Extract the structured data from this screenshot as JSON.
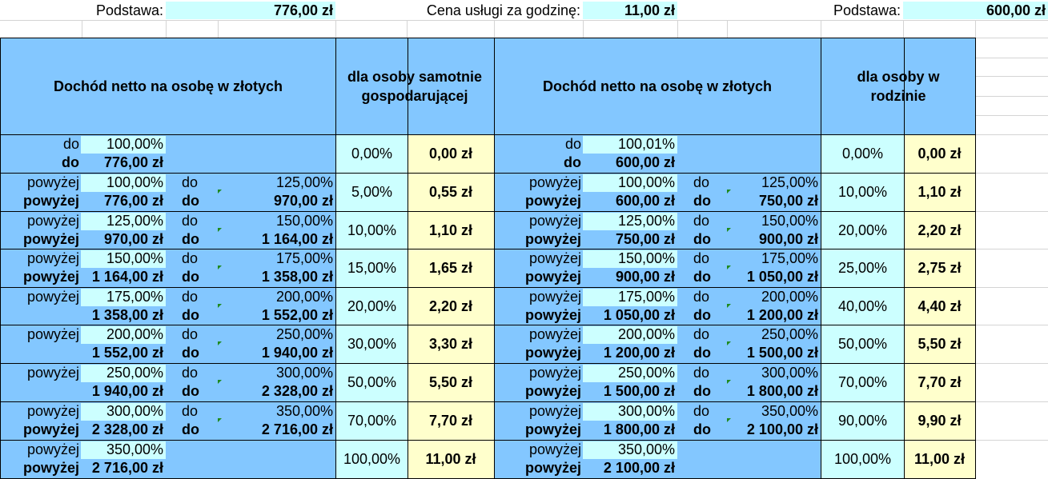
{
  "top": {
    "basis_label_1": "Podstawa:",
    "basis_value_1": "776,00 zł",
    "hourly_label": "Cena usługi za godzinę:",
    "hourly_value": "11,00 zł",
    "basis_label_2": "Podstawa:",
    "basis_value_2": "600,00 zł"
  },
  "headers": {
    "income_1": "Dochód netto na osobę w złotych",
    "single": "dla osoby samotnie gospodarującej",
    "income_2": "Dochód netto na osobę w złotych",
    "family": "dla osoby w rodzinie"
  },
  "left_rows": [
    {
      "l1": "do",
      "p1": "100,00%",
      "l2": "do",
      "a1": "776,00 zł",
      "l3": "",
      "p2": "",
      "l4": "",
      "a2": "",
      "pct": "0,00%",
      "fee": "0,00 zł"
    },
    {
      "l1": "powyżej",
      "p1": "100,00%",
      "l2": "powyżej",
      "a1": "776,00 zł",
      "l3": "do",
      "p2": "125,00%",
      "l4": "do",
      "a2": "970,00 zł",
      "pct": "5,00%",
      "fee": "0,55 zł"
    },
    {
      "l1": "powyżej",
      "p1": "125,00%",
      "l2": "powyżej",
      "a1": "970,00 zł",
      "l3": "do",
      "p2": "150,00%",
      "l4": "do",
      "a2": "1 164,00 zł",
      "pct": "10,00%",
      "fee": "1,10 zł"
    },
    {
      "l1": "powyżej",
      "p1": "150,00%",
      "l2": "powyżej",
      "a1": "1 164,00 zł",
      "l3": "do",
      "p2": "175,00%",
      "l4": "do",
      "a2": "1 358,00 zł",
      "pct": "15,00%",
      "fee": "1,65 zł"
    },
    {
      "l1": "powyżej",
      "p1": "175,00%",
      "l2": "",
      "a1": "1 358,00 zł",
      "l3": "do",
      "p2": "200,00%",
      "l4": "do",
      "a2": "1 552,00 zł",
      "pct": "20,00%",
      "fee": "2,20 zł"
    },
    {
      "l1": "powyżej",
      "p1": "200,00%",
      "l2": "",
      "a1": "1 552,00 zł",
      "l3": "do",
      "p2": "250,00%",
      "l4": "do",
      "a2": "1 940,00 zł",
      "pct": "30,00%",
      "fee": "3,30 zł"
    },
    {
      "l1": "powyżej",
      "p1": "250,00%",
      "l2": "",
      "a1": "1 940,00 zł",
      "l3": "do",
      "p2": "300,00%",
      "l4": "do",
      "a2": "2 328,00 zł",
      "pct": "50,00%",
      "fee": "5,50 zł"
    },
    {
      "l1": "powyżej",
      "p1": "300,00%",
      "l2": "powyżej",
      "a1": "2 328,00 zł",
      "l3": "do",
      "p2": "350,00%",
      "l4": "do",
      "a2": "2 716,00 zł",
      "pct": "70,00%",
      "fee": "7,70 zł"
    },
    {
      "l1": "powyżej",
      "p1": "350,00%",
      "l2": "powyżej",
      "a1": "2 716,00 zł",
      "l3": "",
      "p2": "",
      "l4": "",
      "a2": "",
      "pct": "100,00%",
      "fee": "11,00 zł"
    }
  ],
  "right_rows": [
    {
      "l1": "do",
      "p1": "100,01%",
      "l2": "do",
      "a1": "600,00 zł",
      "l3": "",
      "p2": "",
      "l4": "",
      "a2": "",
      "pct": "0,00%",
      "fee": "0,00 zł"
    },
    {
      "l1": "powyżej",
      "p1": "100,00%",
      "l2": "powyżej",
      "a1": "600,00 zł",
      "l3": "do",
      "p2": "125,00%",
      "l4": "do",
      "a2": "750,00 zł",
      "pct": "10,00%",
      "fee": "1,10 zł"
    },
    {
      "l1": "powyżej",
      "p1": "125,00%",
      "l2": "powyżej",
      "a1": "750,00 zł",
      "l3": "do",
      "p2": "150,00%",
      "l4": "do",
      "a2": "900,00 zł",
      "pct": "20,00%",
      "fee": "2,20 zł"
    },
    {
      "l1": "powyżej",
      "p1": "150,00%",
      "l2": "powyżej",
      "a1": "900,00 zł",
      "l3": "do",
      "p2": "175,00%",
      "l4": "do",
      "a2": "1 050,00 zł",
      "pct": "25,00%",
      "fee": "2,75 zł"
    },
    {
      "l1": "powyżej",
      "p1": "175,00%",
      "l2": "powyżej",
      "a1": "1 050,00 zł",
      "l3": "do",
      "p2": "200,00%",
      "l4": "do",
      "a2": "1 200,00 zł",
      "pct": "40,00%",
      "fee": "4,40 zł"
    },
    {
      "l1": "powyżej",
      "p1": "200,00%",
      "l2": "powyżej",
      "a1": "1 200,00 zł",
      "l3": "do",
      "p2": "250,00%",
      "l4": "do",
      "a2": "1 500,00 zł",
      "pct": "50,00%",
      "fee": "5,50 zł"
    },
    {
      "l1": "powyżej",
      "p1": "250,00%",
      "l2": "powyżej",
      "a1": "1 500,00 zł",
      "l3": "do",
      "p2": "300,00%",
      "l4": "do",
      "a2": "1 800,00 zł",
      "pct": "70,00%",
      "fee": "7,70 zł"
    },
    {
      "l1": "powyżej",
      "p1": "300,00%",
      "l2": "powyżej",
      "a1": "1 800,00 zł",
      "l3": "do",
      "p2": "350,00%",
      "l4": "do",
      "a2": "2 100,00 zł",
      "pct": "90,00%",
      "fee": "9,90 zł"
    },
    {
      "l1": "powyżej",
      "p1": "350,00%",
      "l2": "powyżej",
      "a1": "2 100,00 zł",
      "l3": "",
      "p2": "",
      "l4": "",
      "a2": "",
      "pct": "100,00%",
      "fee": "11,00 zł"
    }
  ],
  "colors": {
    "blue": "#83c7ff",
    "cyan": "#ccffff",
    "yellow": "#ffffcc",
    "gridline": "#d4d4d4"
  }
}
